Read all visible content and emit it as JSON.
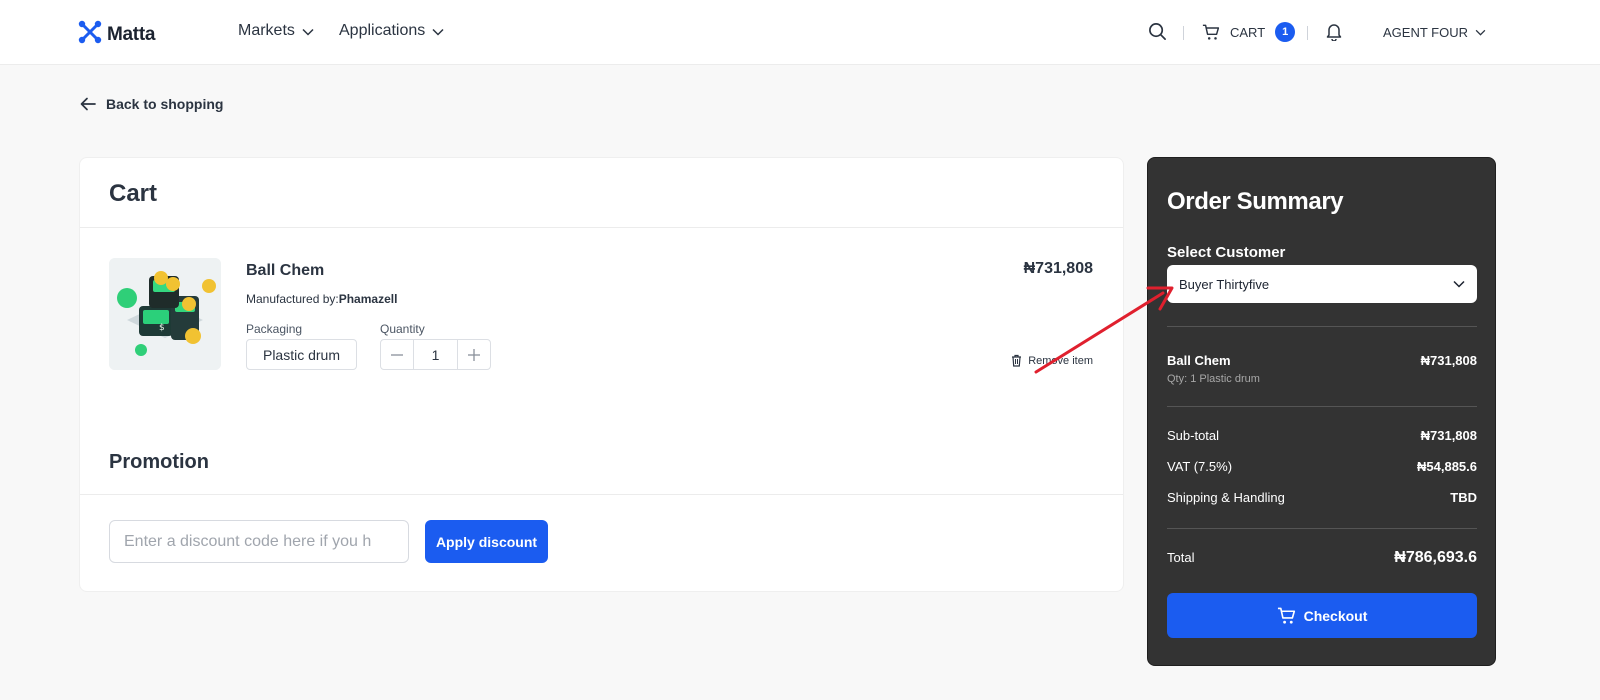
{
  "header": {
    "logo": "Matta",
    "nav": [
      {
        "label": "Markets"
      },
      {
        "label": "Applications"
      }
    ],
    "cart_label": "CART",
    "cart_count": "1",
    "user": "AGENT FOUR"
  },
  "back_link": "Back to shopping",
  "cart": {
    "title": "Cart",
    "item": {
      "name": "Ball Chem",
      "manufactured_prefix": "Manufactured by:",
      "manufacturer": "Phamazell",
      "packaging_label": "Packaging",
      "packaging": "Plastic drum",
      "quantity_label": "Quantity",
      "quantity": "1",
      "price": "₦731,808",
      "remove_label": "Remove item"
    }
  },
  "promotion": {
    "title": "Promotion",
    "placeholder": "Enter a discount code here if you h",
    "apply_label": "Apply discount"
  },
  "summary": {
    "title": "Order Summary",
    "select_label": "Select Customer",
    "selected_customer": "Buyer Thirtyfive",
    "item_name": "Ball Chem",
    "item_price": "₦731,808",
    "item_sub": "Qty: 1 Plastic drum",
    "subtotal_label": "Sub-total",
    "subtotal": "₦731,808",
    "vat_label": "VAT (7.5%)",
    "vat": "₦54,885.6",
    "shipping_label": "Shipping & Handling",
    "shipping": "TBD",
    "total_label": "Total",
    "total": "₦786,693.6",
    "checkout_label": "Checkout"
  },
  "colors": {
    "accent": "#1b5cf0",
    "summary_bg": "#333333",
    "annotation_arrow": "#e0202e"
  }
}
